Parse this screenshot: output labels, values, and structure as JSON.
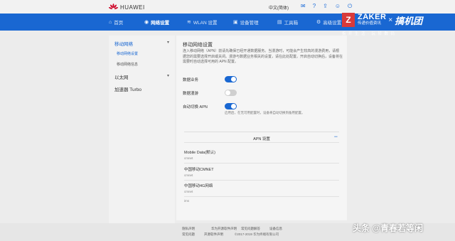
{
  "brand": {
    "name": "HUAWEI"
  },
  "header": {
    "language": "中文(简体)",
    "icons": [
      "chat-icon",
      "help-icon",
      "upload-icon",
      "user-icon",
      "logout-icon"
    ]
  },
  "nav": {
    "items": [
      {
        "label": "首页",
        "icon": "home-icon"
      },
      {
        "label": "网络设置",
        "icon": "network-icon"
      },
      {
        "label": "WLAN 设置",
        "icon": "wifi-icon"
      },
      {
        "label": "设备管理",
        "icon": "devices-icon"
      },
      {
        "label": "工具箱",
        "icon": "toolbox-icon"
      },
      {
        "label": "高级设置",
        "icon": "gear-icon"
      }
    ]
  },
  "watermark": {
    "z": "Z",
    "brand": "ZAKER",
    "sub": "传递价值资讯",
    "x": "×",
    "partner": "搞机团",
    "tagline": "拆 开 生 活 · 玩 转 数 码",
    "credit": "头条 @青春若等闲"
  },
  "sidebar": {
    "group1": "移动网络",
    "sub1": "移动网络设置",
    "sub2": "移动网络信息",
    "group2": "以太网",
    "group3": "加速器 Turbo"
  },
  "main": {
    "title": "移动网络设置",
    "description": "连入移动网络（APN）前请先确保已经开通数据服务。当漫游时，可能会产生较高的漫游费用，请根据您的需要选择开启或关闭。漫游与数据业务相关的设置，请在此处配置。开启自动切换后，设备将在需要时自动选择可用的 APN 配置。",
    "rows": [
      {
        "label": "数据业务",
        "on": true
      },
      {
        "label": "数据漫游",
        "on": false
      },
      {
        "label": "自动切换 APN",
        "on": true
      }
    ],
    "hint": "启用后，在无可用配置时，设备将自动切换到备用配置。",
    "apn_title": "APN 设置",
    "apn_collapse": "−",
    "apn": [
      {
        "name": "Mobile Data(默认)",
        "value": "cmnet"
      },
      {
        "name": "中国移动CMNET",
        "value": "cmnet"
      },
      {
        "name": "中国移动4G网络",
        "value": "cmnet"
      },
      {
        "name": "",
        "value": "ims"
      }
    ]
  },
  "footer": {
    "links": [
      "隐私声明",
      "华为开源软件声明",
      "常见问题解答",
      "设备信息",
      "常见问题",
      "开源软件声明"
    ],
    "copyright": "©2017-2019 华为终端有限公司"
  }
}
